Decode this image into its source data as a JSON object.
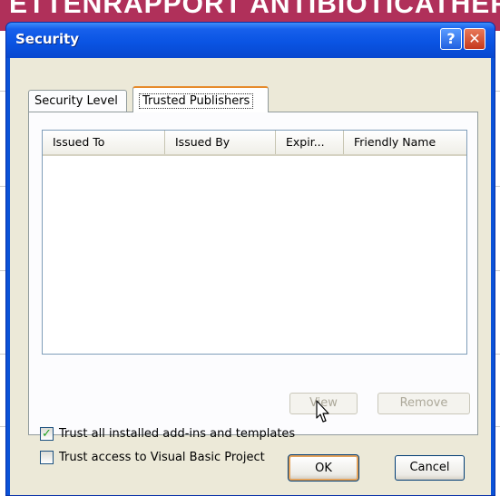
{
  "background": {
    "header_text": "ETTENRAPPORT ANTIBIOTICATHERAPIEBE",
    "header_color": "#b0305a"
  },
  "dialog": {
    "title": "Security",
    "help_label": "?",
    "close_label": "✕",
    "titlebar_color": "#0a54e3"
  },
  "tabs": [
    {
      "label": "Security Level",
      "selected": false
    },
    {
      "label": "Trusted Publishers",
      "selected": true
    }
  ],
  "list": {
    "columns": [
      "Issued To",
      "Issued By",
      "Expir...",
      "Friendly Name"
    ],
    "rows": []
  },
  "buttons": {
    "view": "View",
    "remove": "Remove",
    "ok": "OK",
    "cancel": "Cancel"
  },
  "options": {
    "trust_addins": {
      "label": "Trust all installed add-ins and templates",
      "checked": true
    },
    "trust_vba": {
      "label": "Trust access to Visual Basic Project",
      "checked": false
    }
  },
  "icons": [
    "help-icon",
    "close-icon",
    "checkmark-icon",
    "mouse-pointer-icon"
  ]
}
